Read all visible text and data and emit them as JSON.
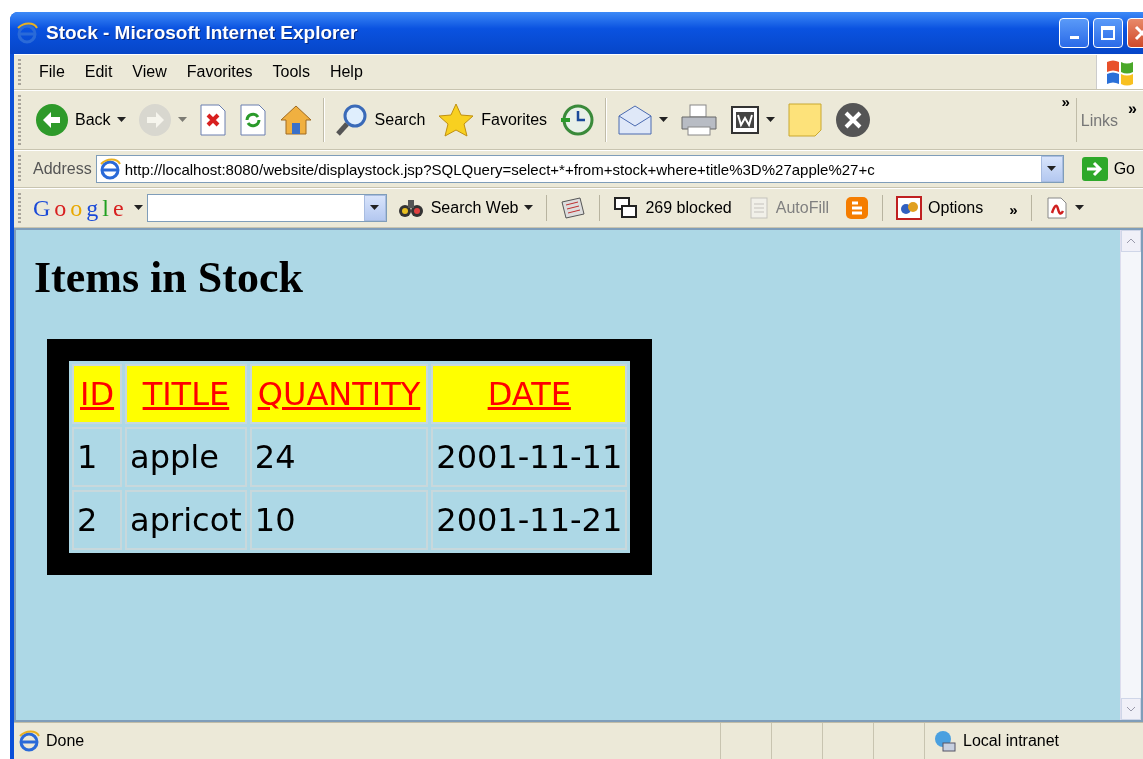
{
  "window": {
    "title": "Stock - Microsoft Internet Explorer"
  },
  "menu": [
    "File",
    "Edit",
    "View",
    "Favorites",
    "Tools",
    "Help"
  ],
  "toolbar": [
    {
      "kind": "back",
      "label": "Back",
      "dropdown": true,
      "disabled": false
    },
    {
      "kind": "forward",
      "dropdown": true,
      "disabled": true
    },
    {
      "kind": "stop",
      "disabled": false
    },
    {
      "kind": "refresh",
      "disabled": false
    },
    {
      "kind": "home",
      "disabled": false
    },
    {
      "kind": "sep"
    },
    {
      "kind": "search",
      "label": "Search",
      "disabled": false
    },
    {
      "kind": "favorites",
      "label": "Favorites",
      "disabled": false
    },
    {
      "kind": "history",
      "disabled": false
    },
    {
      "kind": "sep"
    },
    {
      "kind": "mail",
      "dropdown": true,
      "disabled": false
    },
    {
      "kind": "print",
      "disabled": false
    },
    {
      "kind": "edit",
      "dropdown": true,
      "disabled": false
    },
    {
      "kind": "note",
      "disabled": false
    },
    {
      "kind": "messenger",
      "disabled": false
    }
  ],
  "toolbar_chevron": "»",
  "links": {
    "label": "Links",
    "chevron": "»"
  },
  "address": {
    "label": "Address",
    "value": "http://localhost:8080/website/displaystock.jsp?SQLQuery=select+*+from+stock+where+title%3D%27apple%27+c",
    "go": "Go"
  },
  "google_toolbar": {
    "logo": "Google",
    "search_web": "Search Web",
    "items": [
      {
        "kind": "news",
        "disabled": false
      },
      {
        "kind": "popup",
        "label": "269 blocked",
        "disabled": false
      },
      {
        "kind": "autofill",
        "label": "AutoFill",
        "disabled": true
      },
      {
        "kind": "blogger",
        "disabled": false
      },
      {
        "kind": "options",
        "label": "Options",
        "disabled": false
      }
    ],
    "chevron": "»"
  },
  "page": {
    "heading": "Items in Stock",
    "table": {
      "columns": [
        "ID",
        "TITLE",
        "QUANTITY",
        "DATE"
      ],
      "rows": [
        [
          "1",
          "apple",
          "24",
          "2001-11-11"
        ],
        [
          "2",
          "apricot",
          "10",
          "2001-11-21"
        ]
      ]
    }
  },
  "status_bar": {
    "text": "Done",
    "zone": "Local intranet"
  }
}
